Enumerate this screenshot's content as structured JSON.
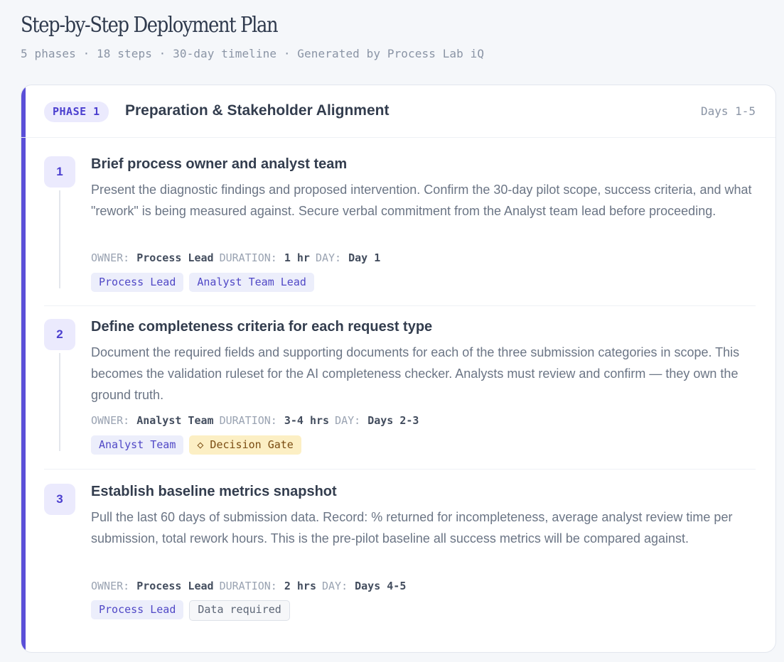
{
  "header": {
    "title": "Step-by-Step Deployment Plan",
    "subtitle": "5 phases · 18 steps · 30-day timeline · Generated by Process Lab iQ"
  },
  "phase": {
    "badge": "PHASE 1",
    "title": "Preparation & Stakeholder Alignment",
    "days": "Days 1-5",
    "accent_color": "#5a4fd8"
  },
  "meta_labels": {
    "owner": "OWNER:",
    "duration": "DURATION:",
    "day": "DAY:"
  },
  "steps": [
    {
      "number": "1",
      "title": "Brief process owner and analyst team",
      "description": "Present the diagnostic findings and proposed intervention. Confirm the 30-day pilot scope, success criteria, and what \"rework\" is being measured against. Secure verbal commitment from the Analyst team lead before proceeding.",
      "owner": "Process Lead",
      "duration": "1 hr",
      "day": "Day 1",
      "tags": [
        "Process Lead",
        "Analyst Team Lead"
      ]
    },
    {
      "number": "2",
      "title": "Define completeness criteria for each request type",
      "description": "Document the required fields and supporting documents for each of the three submission categories in scope. This becomes the validation ruleset for the AI completeness checker. Analysts must review and confirm — they own the ground truth.",
      "owner": "Analyst Team",
      "duration": "3-4 hrs",
      "day": "Days 2-3",
      "tags": [
        "Analyst Team",
        "◇ Decision Gate"
      ]
    },
    {
      "number": "3",
      "title": "Establish baseline metrics snapshot",
      "description": "Pull the last 60 days of submission data. Record: % returned for incompleteness, average analyst review time per submission, total rework hours. This is the pre-pilot baseline all success metrics will be compared against.",
      "owner": "Process Lead",
      "duration": "2 hrs",
      "day": "Days 4-5",
      "tags": [
        "Process Lead",
        "Data required"
      ]
    }
  ]
}
